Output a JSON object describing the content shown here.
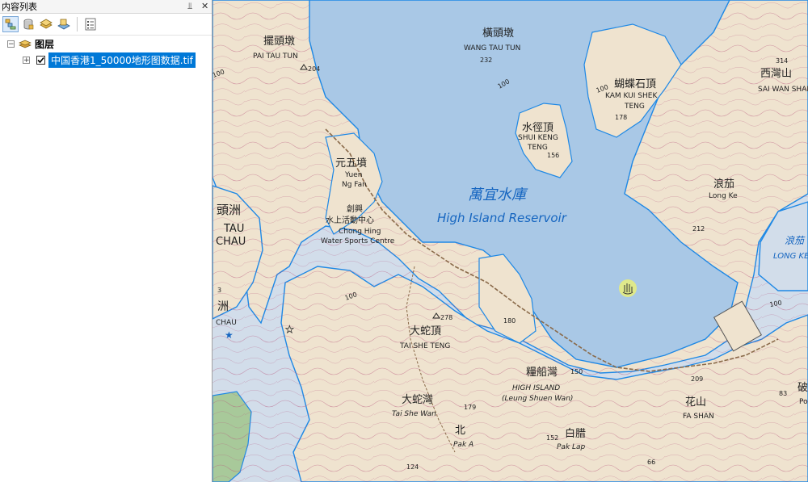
{
  "panel": {
    "title": "内容列表",
    "pin_glyph": "⫫",
    "close_glyph": "✕"
  },
  "toolbar": {
    "buttons": [
      {
        "name": "list-by-drawing-order-icon"
      },
      {
        "name": "list-by-source-icon"
      },
      {
        "name": "list-by-visibility-icon"
      },
      {
        "name": "list-by-selection-icon"
      },
      {
        "name": "options-icon"
      }
    ]
  },
  "tree": {
    "root_label": "图层",
    "layer_label": "中国香港1_50000地形图数据.tif",
    "layer_checked": true
  },
  "map": {
    "labels": {
      "pai_tau_tun_cn": "擺頭墩",
      "pai_tau_tun_en": "PAI TAU TUN",
      "h204": "204",
      "wang_tau_tun_cn": "橫頭墩",
      "wang_tau_tun_en": "WANG TAU TUN",
      "h232": "232",
      "kam_kui_shek_cn": "蝴蝶石頂",
      "kam_kui_shek_en1": "KAM KUI SHEK",
      "kam_kui_shek_en2": "TENG",
      "h178": "178",
      "sai_wan_shan_cn": "西灣山",
      "sai_wan_shan_en": "SAI WAN SHAN",
      "h314": "314",
      "shui_keng_cn": "水徑頂",
      "shui_keng_en1": "SHUI KENG",
      "shui_keng_en2": "TENG",
      "h156": "156",
      "yuen_ng_fan_cn": "元五墳",
      "yuen_ng_fan_en1": "Yuen",
      "yuen_ng_fan_en2": "Ng Fan",
      "chong_hing_cn1": "創興",
      "chong_hing_cn2": "水上活動中心",
      "chong_hing_en1": "Chong Hing",
      "chong_hing_en2": "Water Sports Centre",
      "reservoir_cn": "萬宜水庫",
      "reservoir_en": "High Island Reservoir",
      "long_ke_cn": "浪茄",
      "long_ke_en": "Long Ke",
      "h212": "212",
      "long_ke_wan_cn": "浪茄",
      "long_ke_wan_en": "LONG KE",
      "tau_chau_cn1": "頭洲",
      "tau_chau_en1": "TAU",
      "tau_chau_en2": "CHAU",
      "tau_chau_cn2": "洲",
      "chau_en": "CHAU",
      "h3": "3",
      "h278": "278",
      "tai_she_teng_cn": "大蛇頂",
      "tai_she_teng_en": "TAI SHE TENG",
      "h180": "180",
      "leung_shuen_wan_cn": "糧船灣",
      "high_island_en": "HIGH ISLAND",
      "leung_shuen_wan_en": "(Leung Shuen Wan)",
      "h150": "150",
      "h209": "209",
      "fa_shan_cn": "花山",
      "fa_shan_en": "FA SHAN",
      "tai_she_wan_cn": "大蛇灣",
      "tai_she_wan_en": "Tai She Wan",
      "h179": "179",
      "pak_a_cn": "北",
      "pak_a_en": "Pak A",
      "pak_lap_cn": "白腊",
      "pak_lap_en": "Pak Lap",
      "h152": "152",
      "h124": "124",
      "h66": "66",
      "h83": "83",
      "edge_cn": "破",
      "edge_en": "Po",
      "c100": "100"
    },
    "colors": {
      "land": "#efe3cf",
      "land_alt": "#eadcc4",
      "water": "#a9c8e6",
      "sea": "#d2ddea",
      "coast": "#1e88e5",
      "contour": "#b5517a",
      "road": "#8a6a4a",
      "green": "#a8c99a",
      "cursor": "#e9ee7a"
    }
  }
}
